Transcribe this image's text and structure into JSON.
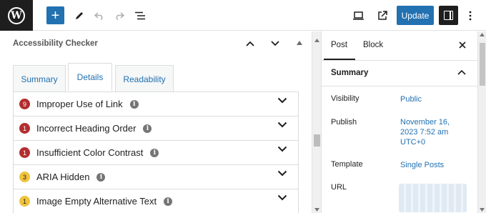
{
  "toolbar": {
    "logo_letter": "W",
    "add_label": "+",
    "update_label": "Update",
    "icons": [
      "wordpress-logo-icon",
      "add-block-icon",
      "pencil-tools-icon",
      "undo-icon",
      "redo-icon",
      "document-overview-icon",
      "preview-desktop-icon",
      "view-post-icon",
      "settings-sidebar-icon",
      "options-menu-icon"
    ]
  },
  "panel": {
    "title": "Accessibility Checker",
    "tabs": [
      {
        "label": "Summary",
        "active": false
      },
      {
        "label": "Details",
        "active": true
      },
      {
        "label": "Readability",
        "active": false
      }
    ],
    "issues": [
      {
        "count": "9",
        "label": "Improper Use of Link",
        "severity": "error"
      },
      {
        "count": "1",
        "label": "Incorrect Heading Order",
        "severity": "error"
      },
      {
        "count": "1",
        "label": "Insufficient Color Contrast",
        "severity": "error"
      },
      {
        "count": "3",
        "label": "ARIA Hidden",
        "severity": "warning"
      },
      {
        "count": "1",
        "label": "Image Empty Alternative Text",
        "severity": "warning"
      }
    ]
  },
  "sidebar": {
    "tabs": [
      {
        "label": "Post",
        "active": true
      },
      {
        "label": "Block",
        "active": false
      }
    ],
    "section_title": "Summary",
    "fields": [
      {
        "label": "Visibility",
        "value": "Public"
      },
      {
        "label": "Publish",
        "value_lines": [
          "November 16,",
          "2023 7:52 am",
          "UTC+0"
        ]
      },
      {
        "label": "Template",
        "value": "Single Posts"
      },
      {
        "label": "URL"
      }
    ]
  },
  "colors": {
    "accent": "#2271b1",
    "error_badge": "#b32d2e",
    "warning_badge": "#f0c33c",
    "dark": "#1e1e1e"
  }
}
